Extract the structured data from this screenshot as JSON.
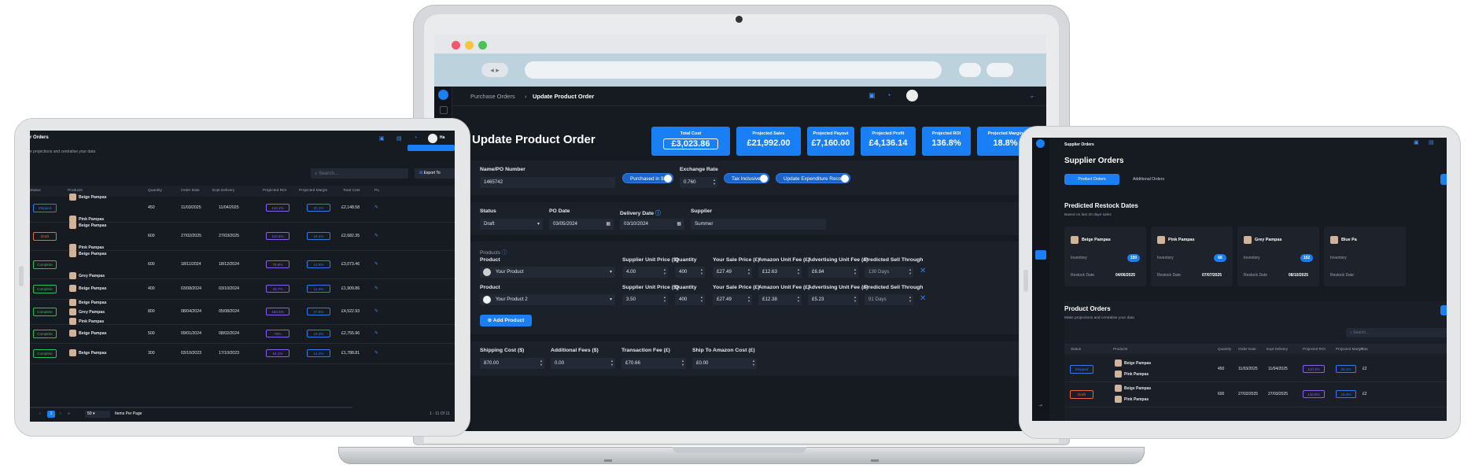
{
  "laptop": {
    "breadcrumb_parent": "Purchase Orders",
    "breadcrumb_sep": "›",
    "breadcrumb_current": "Update Product Order",
    "page_title": "Update Product Order",
    "kpis": [
      {
        "label": "Total Cost",
        "value": "£3,023.86"
      },
      {
        "label": "Projected Sales",
        "value": "£21,992.00"
      },
      {
        "label": "Projected Payout",
        "value": "£7,160.00"
      },
      {
        "label": "Projected Profit",
        "value": "£4,136.14"
      },
      {
        "label": "Projected ROI",
        "value": "136.8%"
      },
      {
        "label": "Projected Margin",
        "value": "18.8%"
      }
    ],
    "name_label": "Name/PO Number",
    "name_value": "1465742",
    "toggle_purchased": "Purchased in $",
    "exchange_label": "Exchange Rate",
    "exchange_value": "0.760",
    "toggle_tax": "Tax Inclusive",
    "toggle_update": "Update Expenditure Record",
    "status_label": "Status",
    "status_value": "Draft",
    "po_date_label": "PO Date",
    "po_date_value": "03/05/2024",
    "delivery_label": "Delivery Date",
    "delivery_value": "03/10/2024",
    "supplier_label": "Supplier",
    "supplier_value": "Summer",
    "products_heading": "Products",
    "col_product": "Product",
    "col_unit_price": "Supplier Unit Price ($)",
    "col_quantity": "Quantity",
    "col_sale_price": "Your Sale Price (£)",
    "col_amazon_fee": "Amazon Unit Fee (£)",
    "col_ad_fee": "Advertising Unit Fee (£)",
    "col_sell_through": "Predicted Sell Through",
    "rows": [
      {
        "product": "Your Product",
        "unit_price": "4.00",
        "quantity": "400",
        "sale_price": "£27.49",
        "amazon_fee": "£12.63",
        "ad_fee": "£6.84",
        "sell_through": "130 Days"
      },
      {
        "product": "Your Product 2",
        "unit_price": "3.50",
        "quantity": "400",
        "sale_price": "£27.49",
        "amazon_fee": "£12.38",
        "ad_fee": "£5.23",
        "sell_through": "91 Days"
      }
    ],
    "add_product": "Add Product",
    "shipping_label": "Shipping Cost ($)",
    "shipping_value": "870.00",
    "additional_label": "Additional Fees ($)",
    "additional_value": "0.00",
    "transaction_label": "Transaction Fee (£)",
    "transaction_value": "£70.66",
    "amazon_ship_label": "Ship To Amazon Cost (£)",
    "amazon_ship_value": "£0.00"
  },
  "left_tablet": {
    "title": "r Orders",
    "subtitle": "e projections and centralise your data",
    "search_placeholder": "Search...",
    "export": "Export To",
    "avatar_text": "Ha",
    "headers": [
      "Status",
      "Products",
      "Quantity",
      "Order Date",
      "Expt Delivery",
      "Projected ROI",
      "Projected Margin",
      "Total Cost",
      "Pu"
    ],
    "rows": [
      {
        "status": "Shipped",
        "products": [
          "Beige Pampas",
          "Pink Pampas"
        ],
        "quantity": "450",
        "order_date": "11/03/2025",
        "delivery": "11/04/2025",
        "roi": "110.1%",
        "margin": "20.1%",
        "cost": "£2,148.58"
      },
      {
        "status": "Draft",
        "products": [
          "Beige Pampas",
          "Pink Pampas"
        ],
        "quantity": "600",
        "order_date": "27/02/2025",
        "delivery": "27/03/2025",
        "roi": "110.6%",
        "margin": "16.4%",
        "cost": "£2,682.35"
      },
      {
        "status": "Complete",
        "products": [
          "Beige Pampas",
          "Grey Pampas"
        ],
        "quantity": "600",
        "order_date": "18/11/2024",
        "delivery": "18/12/2024",
        "roi": "76.8%",
        "margin": "14.6%",
        "cost": "£3,073.46"
      },
      {
        "status": "Complete",
        "products": [
          "Beige Pampas"
        ],
        "quantity": "400",
        "order_date": "03/08/2024",
        "delivery": "03/10/2024",
        "roi": "43.7%",
        "margin": "11.4%",
        "cost": "£1,909.86"
      },
      {
        "status": "Complete",
        "products": [
          "Beige Pampas",
          "Grey Pampas",
          "Pink Pampas"
        ],
        "quantity": "800",
        "order_date": "08/04/2024",
        "delivery": "05/08/2024",
        "roi": "184.5%",
        "margin": "27.6%",
        "cost": "£4,522.93"
      },
      {
        "status": "Complete",
        "products": [
          "Beige Pampas"
        ],
        "quantity": "500",
        "order_date": "09/01/2024",
        "delivery": "08/02/2024",
        "roi": "79%",
        "margin": "15.3%",
        "cost": "£2,755.96"
      },
      {
        "status": "Complete",
        "products": [
          "Beige Pampas"
        ],
        "quantity": "300",
        "order_date": "03/10/2023",
        "delivery": "17/10/2023",
        "roi": "64.1%",
        "margin": "14.2%",
        "cost": "£1,788.81"
      }
    ],
    "page_current": "1",
    "per_page": "50",
    "per_page_label": "Items Per Page",
    "range": "1 - 11 Of 11"
  },
  "right_tablet": {
    "breadcrumb": "Supplier Orders",
    "title": "Supplier Orders",
    "tab_active": "Product Orders",
    "tab_inactive": "Additional Orders",
    "restock_title": "Predicted Restock Dates",
    "restock_sub": "Based on last 30 days sales",
    "inventory_label": "Inventory",
    "restock_date_label": "Restock Date",
    "cards": [
      {
        "name": "Beige Pampas",
        "inventory": "150",
        "date": "04/06/2025"
      },
      {
        "name": "Pink Pampas",
        "inventory": "66",
        "date": "07/07/2025"
      },
      {
        "name": "Grey Pampas",
        "inventory": "152",
        "date": "08/10/2025"
      },
      {
        "name": "Blue Pa",
        "inventory": "",
        "date": ""
      }
    ],
    "orders_title": "Product Orders",
    "orders_sub": "Make projections and centralise your data",
    "search_placeholder": "Search...",
    "headers": [
      "Status",
      "Products",
      "Quantity",
      "Order Date",
      "Expt Delivery",
      "Projected ROI",
      "Projected Margin",
      "Tota"
    ],
    "rows": [
      {
        "status": "Shipped",
        "products": [
          "Beige Pampas",
          "Pink Pampas"
        ],
        "quantity": "450",
        "order_date": "11/03/2025",
        "delivery": "11/04/2025",
        "roi": "110.1%",
        "margin": "20.1%",
        "cost": "£2"
      },
      {
        "status": "Draft",
        "products": [
          "Beige Pampas",
          "Pink Pampas"
        ],
        "quantity": "600",
        "order_date": "27/02/2025",
        "delivery": "27/03/2025",
        "roi": "110.6%",
        "margin": "16.4%",
        "cost": "£2"
      }
    ]
  },
  "colors": {
    "accent": "#1a7ef5",
    "background": "#161a21",
    "panel": "#1c2029",
    "shipped": "#2f7bf0",
    "draft": "#e8693a",
    "complete": "#2fbf55",
    "roi": "#8d5cf6"
  }
}
